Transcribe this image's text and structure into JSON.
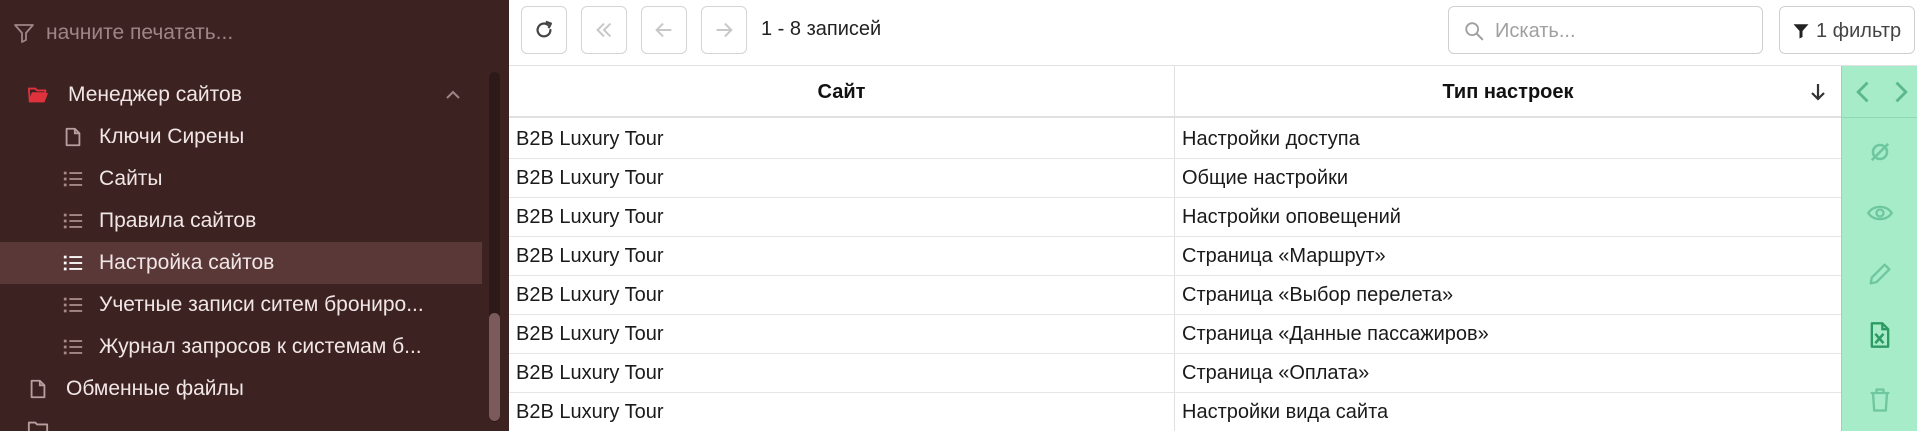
{
  "sidebar": {
    "filter_placeholder": "начните печатать...",
    "items": [
      {
        "label": "Менеджер сайтов"
      },
      {
        "label": "Ключи Сирены"
      },
      {
        "label": "Сайты"
      },
      {
        "label": "Правила сайтов"
      },
      {
        "label": "Настройка сайтов"
      },
      {
        "label": "Учетные записи ситем брониро..."
      },
      {
        "label": "Журнал запросов к системам б..."
      },
      {
        "label": "Обменные файлы"
      }
    ]
  },
  "toolbar": {
    "record_count": "1 - 8 записей",
    "search_placeholder": "Искать...",
    "filter_label": "1 фильтр"
  },
  "grid": {
    "columns": [
      "Сайт",
      "Тип настроек"
    ],
    "rows": [
      [
        "B2B Luxury Tour",
        "Настройки доступа"
      ],
      [
        "B2B Luxury Tour",
        "Общие настройки"
      ],
      [
        "B2B Luxury Tour",
        "Настройки оповещений"
      ],
      [
        "B2B Luxury Tour",
        "Страница «Маршрут»"
      ],
      [
        "B2B Luxury Tour",
        "Страница «Выбор перелета»"
      ],
      [
        "B2B Luxury Tour",
        "Страница «Данные пассажиров»"
      ],
      [
        "B2B Luxury Tour",
        "Страница «Оплата»"
      ],
      [
        "B2B Luxury Tour",
        "Настройки вида сайта"
      ]
    ]
  },
  "colors": {
    "sidebar_bg": "#3d2222",
    "sidebar_selected": "#5a3838",
    "accent_red": "#e0323c",
    "rail_bg": "#a6ecc9",
    "rail_icon": "#6fc79f",
    "rail_icon_active": "#2e9a63"
  },
  "icons": {
    "sidebar_filter": "filter-icon",
    "folder": "folder-open-icon",
    "file": "file-icon",
    "list": "list-icon",
    "refresh": "refresh-icon",
    "first": "double-chevron-left-icon",
    "prev": "arrow-left-icon",
    "next": "arrow-right-icon",
    "search": "search-icon",
    "sort_desc": "arrow-down-icon",
    "rail_actions": [
      "chevron-left-icon",
      "chevron-right-icon",
      "clear-selection-icon",
      "eye-icon",
      "pencil-icon",
      "excel-export-icon",
      "trash-icon"
    ]
  }
}
